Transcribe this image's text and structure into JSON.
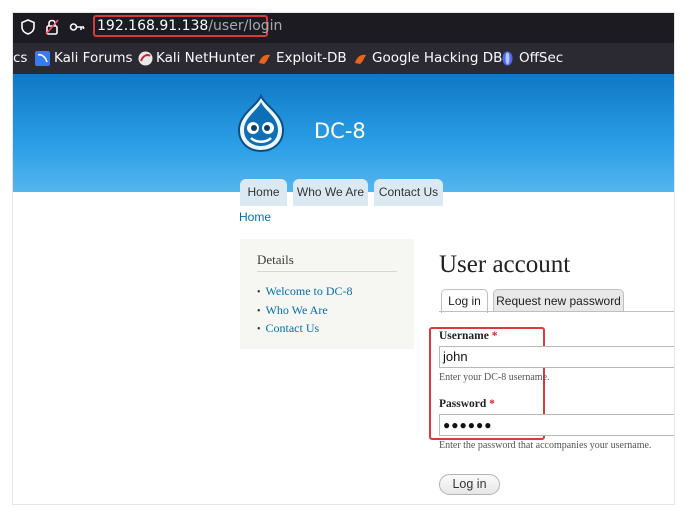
{
  "browser": {
    "url_host": "192.168.91.138",
    "url_path": "/user/login",
    "bookmarks": [
      {
        "label": "cs",
        "icon": "truncated-bookmark"
      },
      {
        "label": "Kali Forums",
        "icon": "kali-forums-icon"
      },
      {
        "label": "Kali NetHunter",
        "icon": "kali-nethunter-icon"
      },
      {
        "label": "Exploit-DB",
        "icon": "exploit-db-icon"
      },
      {
        "label": "Google Hacking DB",
        "icon": "ghdb-icon"
      },
      {
        "label": "OffSec",
        "icon": "offsec-icon"
      }
    ]
  },
  "site": {
    "name": "DC-8",
    "nav": [
      "Home",
      "Who We Are",
      "Contact Us"
    ]
  },
  "breadcrumb": "Home",
  "sidebar": {
    "title": "Details",
    "links": [
      "Welcome to DC-8",
      "Who We Are",
      "Contact Us"
    ]
  },
  "main": {
    "title": "User account",
    "tabs": [
      "Log in",
      "Request new password"
    ],
    "username_label": "Username",
    "required_mark": "*",
    "username_value": "john",
    "username_desc": "Enter your DC-8 username.",
    "password_label": "Password",
    "password_value": "●●●●●●",
    "password_desc": "Enter the password that accompanies your username.",
    "submit_label": "Log in"
  },
  "colors": {
    "highlight": "#d93a3a",
    "header_blue": "#0f78c4",
    "link": "#0071b3"
  }
}
